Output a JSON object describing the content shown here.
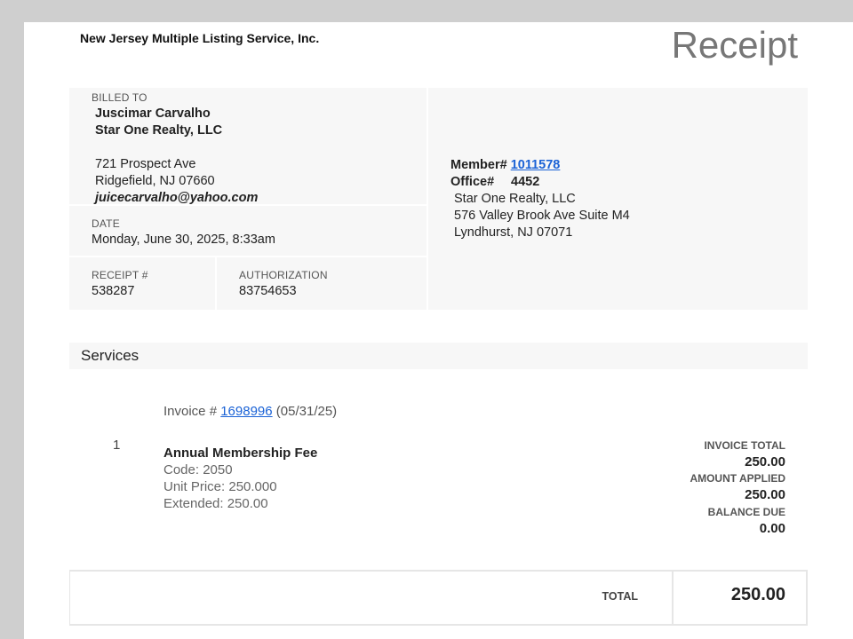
{
  "header": {
    "org_name": "New Jersey Multiple Listing Service, Inc.",
    "title": "Receipt"
  },
  "billed_to": {
    "label": "BILLED TO",
    "name": "Juscimar Carvalho",
    "company": "Star One Realty, LLC",
    "address1": "721 Prospect Ave",
    "address2": "Ridgefield, NJ 07660",
    "email": "juicecarvalho@yahoo.com"
  },
  "date": {
    "label": "DATE",
    "value": "Monday, June 30, 2025, 8:33am"
  },
  "receipt": {
    "label": "RECEIPT #",
    "value": "538287"
  },
  "authorization": {
    "label": "AUTHORIZATION",
    "value": "83754653"
  },
  "member": {
    "member_label": "Member#",
    "member_number": "1011578",
    "office_label": "Office#",
    "office_number": "4452",
    "office_name": "Star One Realty, LLC",
    "office_address1": "576 Valley Brook Ave Suite M4",
    "office_address2": "Lyndhurst, NJ 07071"
  },
  "services": {
    "heading": "Services",
    "line_number": "1",
    "invoice_prefix": "Invoice #",
    "invoice_number": "1698996",
    "invoice_date": "(05/31/25)",
    "item_title": "Annual Membership Fee",
    "code": "Code: 2050",
    "unit_price": "Unit Price: 250.000",
    "extended": "Extended: 250.00",
    "invoice_total_label": "INVOICE TOTAL",
    "invoice_total": "250.00",
    "amount_applied_label": "AMOUNT APPLIED",
    "amount_applied": "250.00",
    "balance_due_label": "BALANCE DUE",
    "balance_due": "0.00"
  },
  "total": {
    "label": "TOTAL",
    "value": "250.00"
  },
  "colors": {
    "link": "#1a62d6",
    "panel": "#f7f7f7",
    "backdrop": "#cfcfcf"
  }
}
